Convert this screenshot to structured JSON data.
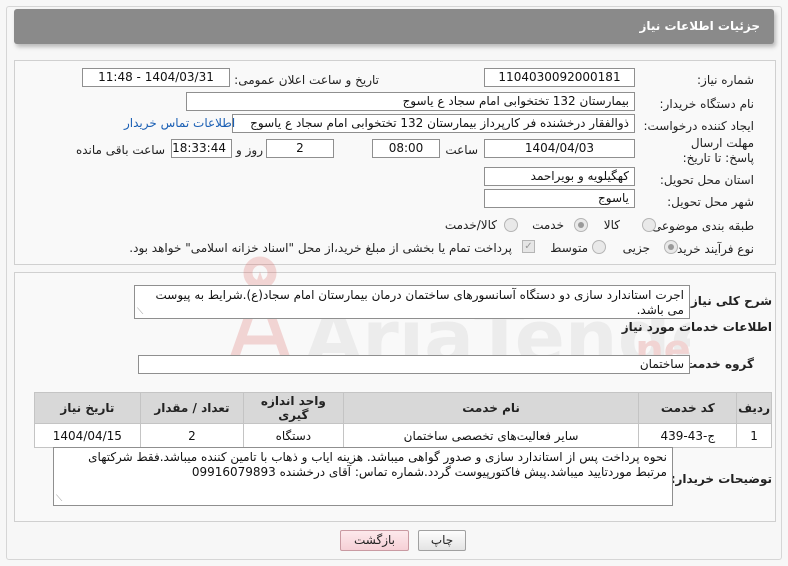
{
  "header": {
    "title": "جزئیات اطلاعات نیاز"
  },
  "form": {
    "need_number_label": "شماره نیاز:",
    "need_number": "1104030092000181",
    "announce_label": "تاریخ و ساعت اعلان عمومی:",
    "announce_value": "1404/03/31 - 11:48",
    "buyer_org_label": "نام دستگاه خریدار:",
    "buyer_org": "بیمارستان 132 تختخوابی امام سجاد  ع  یاسوج",
    "creator_label": "ایجاد کننده درخواست:",
    "creator": "ذوالفقار درخشنده فر کارپرداز بیمارستان 132 تختخوابی امام سجاد  ع  یاسوج",
    "buyer_contact_link": "اطلاعات تماس خریدار",
    "deadline_label": "مهلت ارسال پاسخ: تا تاریخ:",
    "deadline_date": "1404/04/03",
    "time_label": "ساعت",
    "deadline_time": "08:00",
    "days_value": "2",
    "days_label": "روز و",
    "remaining_time": "18:33:44",
    "remaining_label": "ساعت باقی مانده",
    "province_label": "استان محل تحویل:",
    "province": "کهگیلویه و بویراحمد",
    "city_label": "شهر محل تحویل:",
    "city": "یاسوج",
    "category_label": "طبقه بندی موضوعی:",
    "category_options": [
      "کالا",
      "خدمت",
      "کالا/خدمت"
    ],
    "category_selected": "خدمت",
    "process_label": "نوع فرآیند خرید :",
    "process_options": [
      "جزیی",
      "متوسط"
    ],
    "process_selected": "جزیی",
    "payment_note": "پرداخت تمام یا بخشی از مبلغ خرید،از محل \"اسناد خزانه اسلامی\" خواهد بود."
  },
  "details": {
    "summary_label": "شرح کلی نیاز:",
    "summary": "اجرت استاندارد سازی دو دستگاه  آسانسورهای ساختمان درمان بیمارستان امام سجاد(ع).شرایط به پیوست می باشد.",
    "services_title": "اطلاعات خدمات مورد نیاز",
    "service_group_label": "گروه خدمت:",
    "service_group": "ساختمان",
    "table_headers": [
      "ردیف",
      "کد خدمت",
      "نام خدمت",
      "واحد اندازه گیری",
      "تعداد / مقدار",
      "تاریخ نیاز"
    ],
    "rows": [
      [
        "1",
        "ج-43-439",
        "سایر فعالیت‌های تخصصی ساختمان",
        "دستگاه",
        "2",
        "1404/04/15"
      ]
    ],
    "buyer_notes_label": "توضیحات خریدار:",
    "buyer_notes": "نحوه پرداخت پس از استاندارد سازی و صدور گواهی میباشد. هزینه ایاب و ذهاب با تامین کننده میباشد.فقط شرکتهای مرتبط موردتایید میباشد.پیش فاکتورپیوست گردد.شماره تماس: آقای درخشنده 09916079893"
  },
  "buttons": {
    "print": "چاپ",
    "back": "بازگشت"
  },
  "colors": {
    "header_bg": "#8a8a8a",
    "link": "#1a5fb4",
    "watermark": "#d9534f"
  },
  "watermark_text": "AriaTender.neT"
}
